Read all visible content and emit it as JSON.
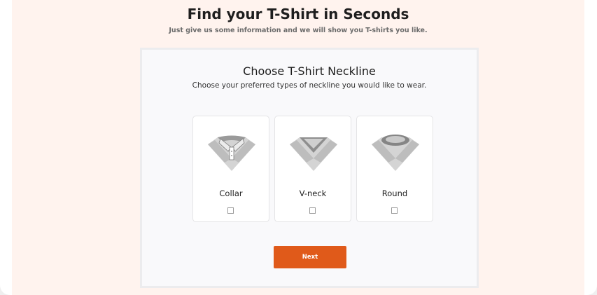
{
  "header": {
    "title": "Find your T-Shirt in Seconds",
    "subtitle": "Just give us some information and we will show you T-shirts you like."
  },
  "step": {
    "title": "Choose T-Shirt Neckline",
    "subtitle": "Choose your preferred types of neckline you would like to wear.",
    "options": [
      {
        "label": "Collar",
        "icon": "collar-neckline-icon",
        "checked": false
      },
      {
        "label": "V-neck",
        "icon": "v-neck-neckline-icon",
        "checked": false
      },
      {
        "label": "Round",
        "icon": "round-neckline-icon",
        "checked": false
      }
    ],
    "next_label": "Next"
  },
  "colors": {
    "accent": "#e05a1a",
    "hero_background": "#fff3ee",
    "panel_background": "#f9f9fb"
  }
}
